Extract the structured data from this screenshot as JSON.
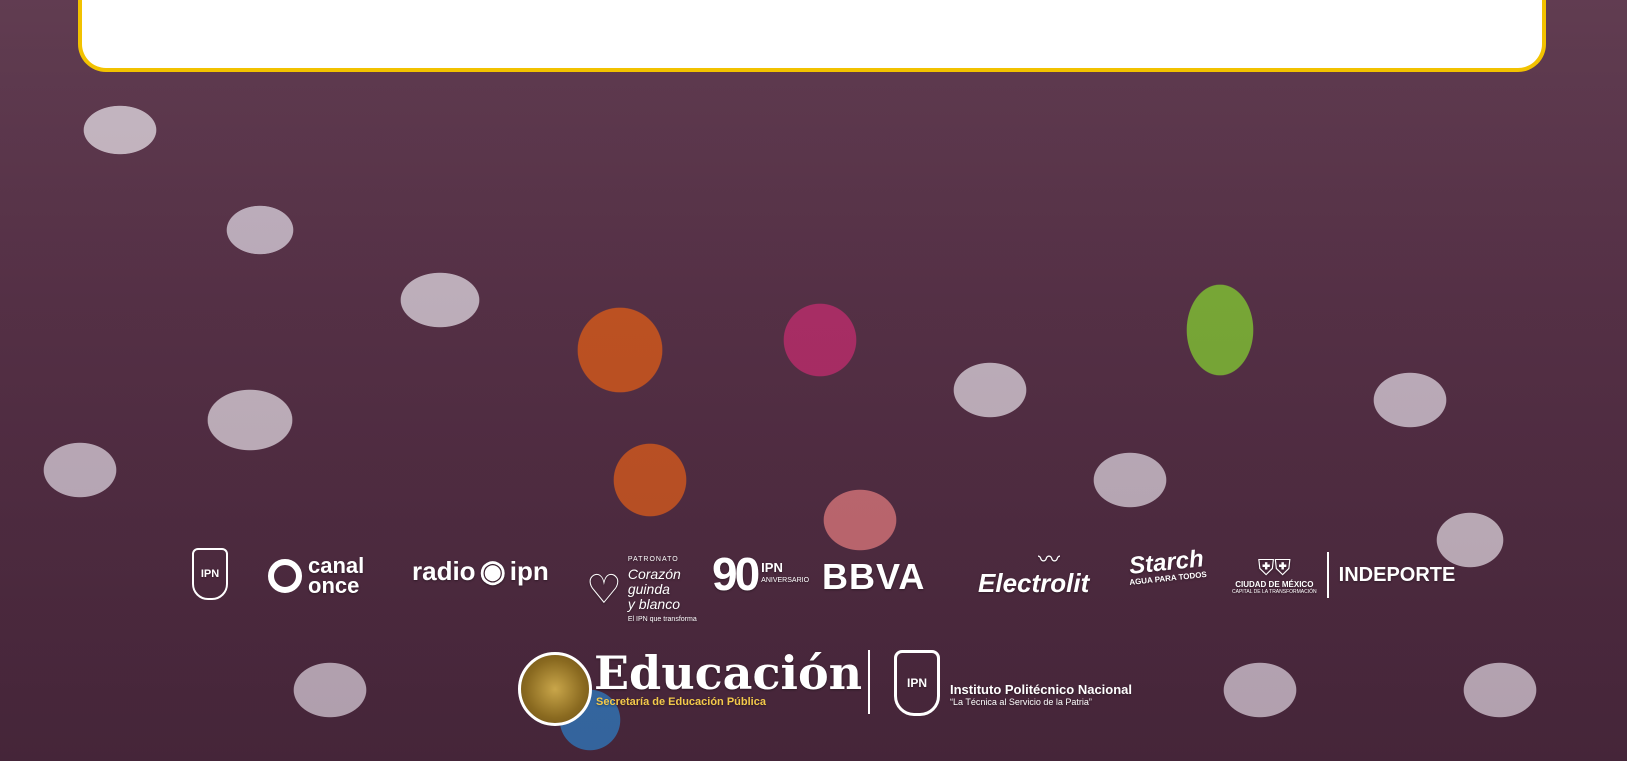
{
  "header": {
    "card": ""
  },
  "sponsors": {
    "ipn": {
      "label": "IPN"
    },
    "canal_once": {
      "label": "canal\nonce"
    },
    "radio_ipn": {
      "label": "radio",
      "suffix": "ipn"
    },
    "corazon": {
      "small": "PATRONATO",
      "line1": "Corazón",
      "line2": "guinda",
      "line3": "y blanco",
      "tag": "El IPN que transforma"
    },
    "ipn90": {
      "number": "90",
      "label": "IPN",
      "sub": "ANIVERSARIO"
    },
    "bbva": {
      "label": "BBVA"
    },
    "electrolit": {
      "label": "Electrolit"
    },
    "starch": {
      "label": "Starch",
      "tag": "AGUA PARA TODOS"
    },
    "cdmx": {
      "name": "CIUDAD DE MÉXICO",
      "tag": "CAPITAL DE LA TRANSFORMACIÓN",
      "indeporte": "INDEPORTE"
    },
    "educacion": {
      "label": "Educación",
      "sub": "Secretaría de Educación Pública"
    },
    "ipn_full": {
      "name": "Instituto Politécnico Nacional",
      "tag": "“La Técnica al Servicio de la Patria”"
    }
  },
  "colors": {
    "card_border": "#f2c200",
    "accent_gold": "#f3c94a"
  }
}
